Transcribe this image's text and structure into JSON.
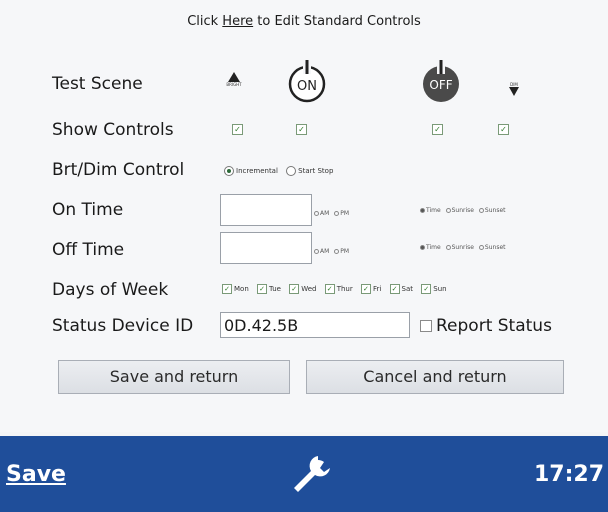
{
  "header": {
    "prefix": "Click ",
    "link": "Here",
    "suffix": " to Edit Standard Controls"
  },
  "labels": {
    "test_scene": "Test Scene",
    "show_controls": "Show Controls",
    "brt_dim": "Brt/Dim Control",
    "on_time": "On Time",
    "off_time": "Off Time",
    "days_of_week": "Days of Week",
    "status_device_id": "Status Device ID"
  },
  "scene": {
    "bright_label": "BRIGHT",
    "on_label": "ON",
    "off_label": "OFF",
    "dim_label": "DIM"
  },
  "brt_dim": {
    "options": [
      "Incremental",
      "Start Stop"
    ],
    "selected": "Incremental"
  },
  "time_fields": {
    "am": "AM",
    "pm": "PM",
    "time": "Time",
    "sunrise": "Sunrise",
    "sunset": "Sunset",
    "on_value": "",
    "off_value": ""
  },
  "days": [
    "Mon",
    "Tue",
    "Wed",
    "Thur",
    "Fri",
    "Sat",
    "Sun"
  ],
  "status_device_id_value": "0D.42.5B",
  "report_status_label": "Report Status",
  "buttons": {
    "save_return": "Save and return",
    "cancel_return": "Cancel and return"
  },
  "taskbar": {
    "save": "Save",
    "clock": "17:27",
    "icon": "wrench-icon"
  },
  "colors": {
    "taskbar": "#1f4e9a",
    "on_off_dark": "#4a4a4a"
  }
}
